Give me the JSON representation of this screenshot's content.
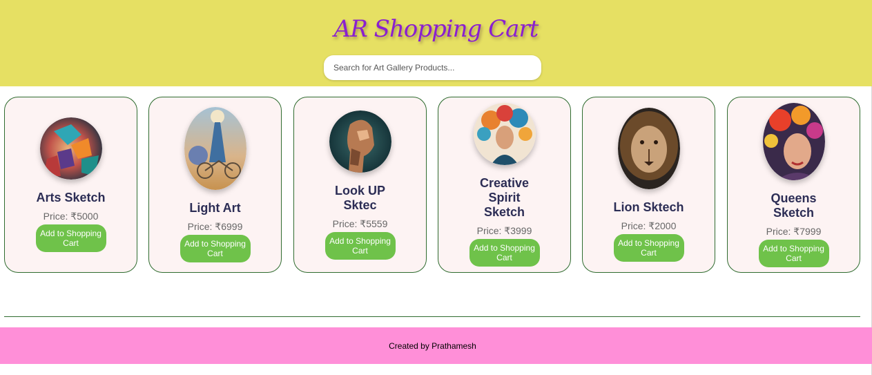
{
  "header": {
    "title": "AR Shopping Cart",
    "search": {
      "placeholder": "Search for Art Gallery Products...",
      "value": ""
    }
  },
  "products": [
    {
      "name": "Arts Sketch",
      "price": "Price: ₹5000",
      "button": "Add to Shopping Cart",
      "image": "abstract-face-art"
    },
    {
      "name": "Light Art",
      "price": "Price: ₹6999",
      "button": "Add to Shopping Cart",
      "image": "woman-bicycle-flowers-art"
    },
    {
      "name": "Look UP Sktec",
      "price": "Price: ₹5559",
      "button": "Add to Shopping Cart",
      "image": "cyborg-head-art"
    },
    {
      "name": "Creative Spirit Sketch",
      "price": "Price: ₹3999",
      "button": "Add to Shopping Cart",
      "image": "woman-colorful-hair-art"
    },
    {
      "name": "Lion Sktech",
      "price": "Price: ₹2000",
      "button": "Add to Shopping Cart",
      "image": "lion-portrait-art"
    },
    {
      "name": "Queens Sketch",
      "price": "Price: ₹7999",
      "button": "Add to Shopping Cart",
      "image": "woman-flower-crown-art"
    }
  ],
  "footer": {
    "text": "Created by Prathamesh"
  },
  "colors": {
    "header_bg": "#e6e063",
    "title": "#8a1fd0",
    "card_bg": "#fdf3f3",
    "card_border": "#2e6b2e",
    "button_bg": "#6fc24a",
    "footer_bg": "#ff8fd8"
  }
}
